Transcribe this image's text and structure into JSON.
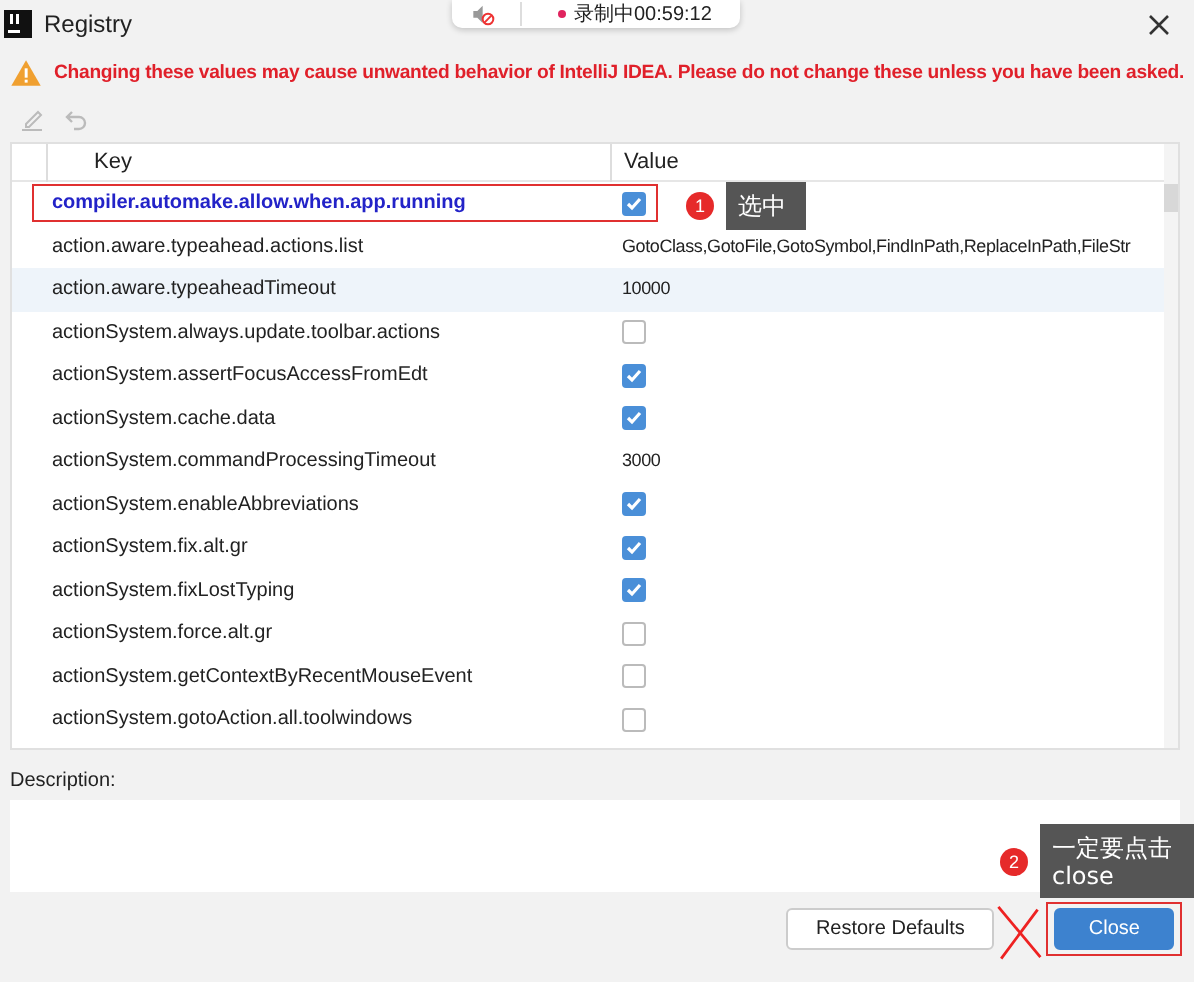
{
  "window": {
    "title": "Registry"
  },
  "recording": {
    "status": "录制中00:59:12"
  },
  "warning": "Changing these values may cause unwanted behavior of IntelliJ IDEA. Please do not change these unless you have been asked.",
  "table": {
    "columns": [
      "Key",
      "Value"
    ],
    "rows": [
      {
        "key": "compiler.automake.allow.when.app.running",
        "kind": "checkbox",
        "checked": true,
        "modified": true,
        "selected": false
      },
      {
        "key": "action.aware.typeahead.actions.list",
        "kind": "text",
        "value": "GotoClass,GotoFile,GotoSymbol,FindInPath,ReplaceInPath,FileStr",
        "modified": false,
        "selected": false
      },
      {
        "key": "action.aware.typeaheadTimeout",
        "kind": "text",
        "value": "10000",
        "modified": false,
        "selected": true
      },
      {
        "key": "actionSystem.always.update.toolbar.actions",
        "kind": "checkbox",
        "checked": false,
        "modified": false,
        "selected": false
      },
      {
        "key": "actionSystem.assertFocusAccessFromEdt",
        "kind": "checkbox",
        "checked": true,
        "modified": false,
        "selected": false
      },
      {
        "key": "actionSystem.cache.data",
        "kind": "checkbox",
        "checked": true,
        "modified": false,
        "selected": false
      },
      {
        "key": "actionSystem.commandProcessingTimeout",
        "kind": "text",
        "value": "3000",
        "modified": false,
        "selected": false
      },
      {
        "key": "actionSystem.enableAbbreviations",
        "kind": "checkbox",
        "checked": true,
        "modified": false,
        "selected": false
      },
      {
        "key": "actionSystem.fix.alt.gr",
        "kind": "checkbox",
        "checked": true,
        "modified": false,
        "selected": false
      },
      {
        "key": "actionSystem.fixLostTyping",
        "kind": "checkbox",
        "checked": true,
        "modified": false,
        "selected": false
      },
      {
        "key": "actionSystem.force.alt.gr",
        "kind": "checkbox",
        "checked": false,
        "modified": false,
        "selected": false
      },
      {
        "key": "actionSystem.getContextByRecentMouseEvent",
        "kind": "checkbox",
        "checked": false,
        "modified": false,
        "selected": false
      },
      {
        "key": "actionSystem.gotoAction.all.toolwindows",
        "kind": "checkbox",
        "checked": false,
        "modified": false,
        "selected": false
      }
    ]
  },
  "description": {
    "label": "Description:"
  },
  "buttons": [
    {
      "label": "Restore Defaults",
      "primary": false
    },
    {
      "label": "Close",
      "primary": true
    }
  ],
  "annotations": [
    {
      "number": "1",
      "text": "选中"
    },
    {
      "number": "2",
      "text": "一定要点击\nclose"
    }
  ]
}
